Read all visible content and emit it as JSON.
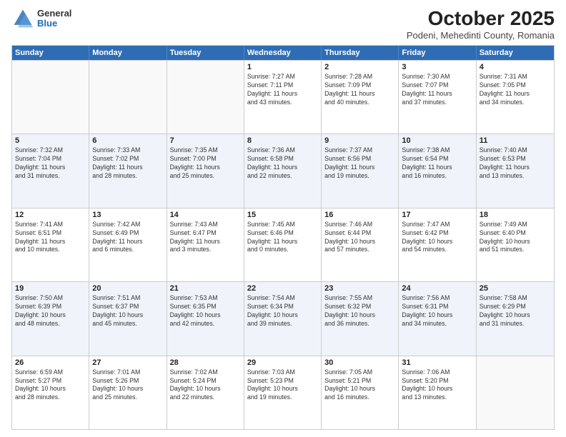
{
  "logo": {
    "general": "General",
    "blue": "Blue"
  },
  "title": "October 2025",
  "subtitle": "Podeni, Mehedinti County, Romania",
  "days": [
    "Sunday",
    "Monday",
    "Tuesday",
    "Wednesday",
    "Thursday",
    "Friday",
    "Saturday"
  ],
  "weeks": [
    [
      {
        "day": "",
        "info": ""
      },
      {
        "day": "",
        "info": ""
      },
      {
        "day": "",
        "info": ""
      },
      {
        "day": "1",
        "info": "Sunrise: 7:27 AM\nSunset: 7:11 PM\nDaylight: 11 hours\nand 43 minutes."
      },
      {
        "day": "2",
        "info": "Sunrise: 7:28 AM\nSunset: 7:09 PM\nDaylight: 11 hours\nand 40 minutes."
      },
      {
        "day": "3",
        "info": "Sunrise: 7:30 AM\nSunset: 7:07 PM\nDaylight: 11 hours\nand 37 minutes."
      },
      {
        "day": "4",
        "info": "Sunrise: 7:31 AM\nSunset: 7:05 PM\nDaylight: 11 hours\nand 34 minutes."
      }
    ],
    [
      {
        "day": "5",
        "info": "Sunrise: 7:32 AM\nSunset: 7:04 PM\nDaylight: 11 hours\nand 31 minutes."
      },
      {
        "day": "6",
        "info": "Sunrise: 7:33 AM\nSunset: 7:02 PM\nDaylight: 11 hours\nand 28 minutes."
      },
      {
        "day": "7",
        "info": "Sunrise: 7:35 AM\nSunset: 7:00 PM\nDaylight: 11 hours\nand 25 minutes."
      },
      {
        "day": "8",
        "info": "Sunrise: 7:36 AM\nSunset: 6:58 PM\nDaylight: 11 hours\nand 22 minutes."
      },
      {
        "day": "9",
        "info": "Sunrise: 7:37 AM\nSunset: 6:56 PM\nDaylight: 11 hours\nand 19 minutes."
      },
      {
        "day": "10",
        "info": "Sunrise: 7:38 AM\nSunset: 6:54 PM\nDaylight: 11 hours\nand 16 minutes."
      },
      {
        "day": "11",
        "info": "Sunrise: 7:40 AM\nSunset: 6:53 PM\nDaylight: 11 hours\nand 13 minutes."
      }
    ],
    [
      {
        "day": "12",
        "info": "Sunrise: 7:41 AM\nSunset: 6:51 PM\nDaylight: 11 hours\nand 10 minutes."
      },
      {
        "day": "13",
        "info": "Sunrise: 7:42 AM\nSunset: 6:49 PM\nDaylight: 11 hours\nand 6 minutes."
      },
      {
        "day": "14",
        "info": "Sunrise: 7:43 AM\nSunset: 6:47 PM\nDaylight: 11 hours\nand 3 minutes."
      },
      {
        "day": "15",
        "info": "Sunrise: 7:45 AM\nSunset: 6:46 PM\nDaylight: 11 hours\nand 0 minutes."
      },
      {
        "day": "16",
        "info": "Sunrise: 7:46 AM\nSunset: 6:44 PM\nDaylight: 10 hours\nand 57 minutes."
      },
      {
        "day": "17",
        "info": "Sunrise: 7:47 AM\nSunset: 6:42 PM\nDaylight: 10 hours\nand 54 minutes."
      },
      {
        "day": "18",
        "info": "Sunrise: 7:49 AM\nSunset: 6:40 PM\nDaylight: 10 hours\nand 51 minutes."
      }
    ],
    [
      {
        "day": "19",
        "info": "Sunrise: 7:50 AM\nSunset: 6:39 PM\nDaylight: 10 hours\nand 48 minutes."
      },
      {
        "day": "20",
        "info": "Sunrise: 7:51 AM\nSunset: 6:37 PM\nDaylight: 10 hours\nand 45 minutes."
      },
      {
        "day": "21",
        "info": "Sunrise: 7:53 AM\nSunset: 6:35 PM\nDaylight: 10 hours\nand 42 minutes."
      },
      {
        "day": "22",
        "info": "Sunrise: 7:54 AM\nSunset: 6:34 PM\nDaylight: 10 hours\nand 39 minutes."
      },
      {
        "day": "23",
        "info": "Sunrise: 7:55 AM\nSunset: 6:32 PM\nDaylight: 10 hours\nand 36 minutes."
      },
      {
        "day": "24",
        "info": "Sunrise: 7:56 AM\nSunset: 6:31 PM\nDaylight: 10 hours\nand 34 minutes."
      },
      {
        "day": "25",
        "info": "Sunrise: 7:58 AM\nSunset: 6:29 PM\nDaylight: 10 hours\nand 31 minutes."
      }
    ],
    [
      {
        "day": "26",
        "info": "Sunrise: 6:59 AM\nSunset: 5:27 PM\nDaylight: 10 hours\nand 28 minutes."
      },
      {
        "day": "27",
        "info": "Sunrise: 7:01 AM\nSunset: 5:26 PM\nDaylight: 10 hours\nand 25 minutes."
      },
      {
        "day": "28",
        "info": "Sunrise: 7:02 AM\nSunset: 5:24 PM\nDaylight: 10 hours\nand 22 minutes."
      },
      {
        "day": "29",
        "info": "Sunrise: 7:03 AM\nSunset: 5:23 PM\nDaylight: 10 hours\nand 19 minutes."
      },
      {
        "day": "30",
        "info": "Sunrise: 7:05 AM\nSunset: 5:21 PM\nDaylight: 10 hours\nand 16 minutes."
      },
      {
        "day": "31",
        "info": "Sunrise: 7:06 AM\nSunset: 5:20 PM\nDaylight: 10 hours\nand 13 minutes."
      },
      {
        "day": "",
        "info": ""
      }
    ]
  ]
}
